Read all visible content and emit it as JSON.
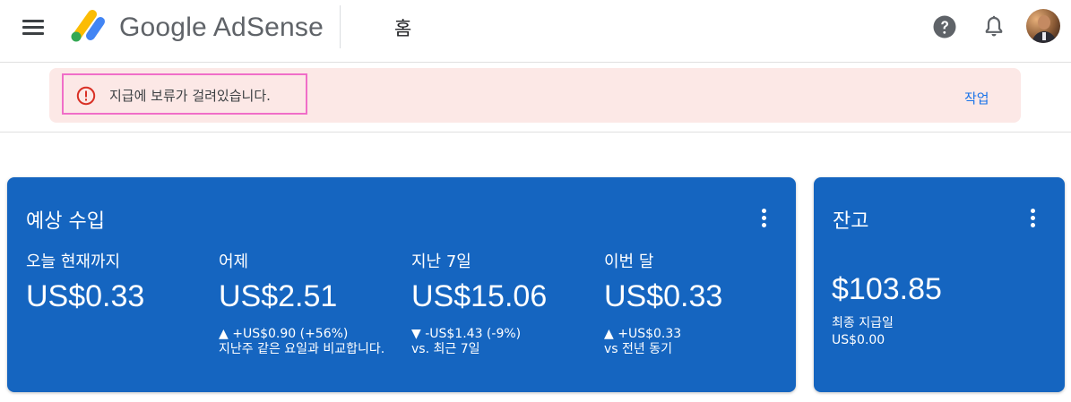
{
  "header": {
    "brand_google": "Google",
    "brand_product": "AdSense",
    "page_title": "홈"
  },
  "alert": {
    "message": "지급에 보류가 걸려있습니다.",
    "action_label": "작업",
    "accent_color": "#d93025",
    "background_color": "#fce8e6"
  },
  "earnings_card": {
    "title": "예상 수입",
    "background_color": "#1565c0",
    "metrics": [
      {
        "label": "오늘 현재까지",
        "value": "US$0.33",
        "change": "",
        "compare": ""
      },
      {
        "label": "어제",
        "value": "US$2.51",
        "change": "▲ +US$0.90 (+56%)",
        "compare": "지난주 같은 요일과 비교합니다."
      },
      {
        "label": "지난 7일",
        "value": "US$15.06",
        "change": "▼ -US$1.43 (-9%)",
        "compare": "vs. 최근 7일"
      },
      {
        "label": "이번 달",
        "value": "US$0.33",
        "change": "▲ +US$0.33",
        "compare": "vs 전년 동기"
      }
    ]
  },
  "balance_card": {
    "title": "잔고",
    "value": "$103.85",
    "last_payment_label": "최종 지급일",
    "last_payment_value": "US$0.00"
  },
  "icons": {
    "menu": "menu-icon",
    "help": "help-icon",
    "notifications": "bell-icon",
    "alert": "error-icon",
    "more": "more-vert-icon"
  }
}
